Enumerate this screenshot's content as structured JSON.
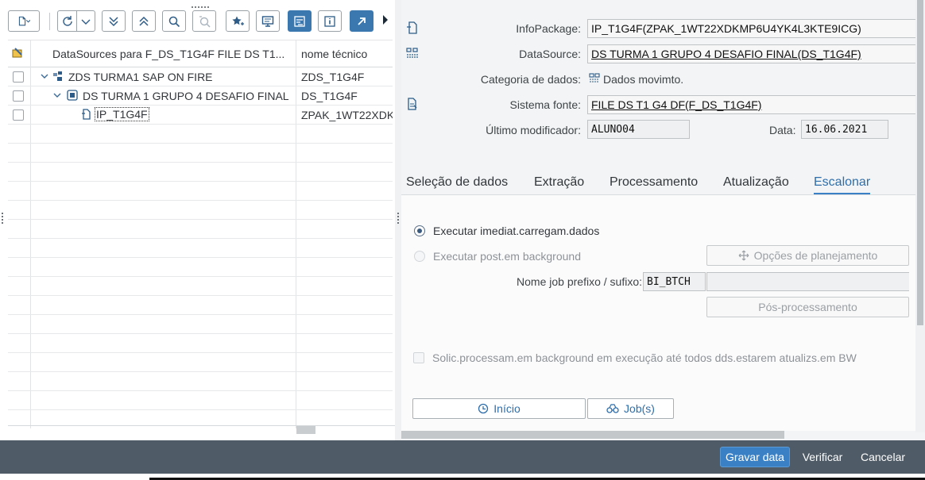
{
  "tree": {
    "header_col1": "DataSources para F_DS_T1G4F FILE DS T1...",
    "header_col2": "nome técnico",
    "rows": [
      {
        "label": "ZDS TURMA1 SAP ON FIRE",
        "tech": "ZDS_T1G4F",
        "level": 1
      },
      {
        "label": "DS TURMA 1 GRUPO 4 DESAFIO FINAL",
        "tech": "DS_T1G4F",
        "level": 2
      },
      {
        "label": "IP_T1G4F",
        "tech": "ZPAK_1WT22XDK",
        "level": 3
      }
    ]
  },
  "details": {
    "infopackage_label": "InfoPackage:",
    "infopackage_value": "IP_T1G4F(ZPAK_1WT22XDKMP6U4YK4L3KTE9ICG)",
    "datasource_label": "DataSource:",
    "datasource_value": "DS TURMA 1 GRUPO 4 DESAFIO FINAL(DS_T1G4F)",
    "category_label": "Categoria de dados:",
    "category_value": "Dados movimto.",
    "source_label": "Sistema fonte:",
    "source_value": "FILE DS T1 G4 DF(F_DS_T1G4F)",
    "modifier_label": "Último modificador:",
    "modifier_value": "ALUNO04",
    "date_label": "Data:",
    "date_value": "16.06.2021"
  },
  "tabs": [
    "Seleção de dados",
    "Extração",
    "Processamento",
    "Atualização",
    "Escalonar"
  ],
  "active_tab": "Escalonar",
  "schedule": {
    "radio_immediate": "Executar imediat.carregam.dados",
    "radio_background": "Executar post.em background",
    "planning_options": "Opções de planejamento",
    "job_prefix_label": "Nome job prefixo / sufixo:",
    "job_prefix_value": "BI_BTCH",
    "job_suffix_value": "",
    "post_processing": "Pós-processamento",
    "checkbox_label": "Solic.processam.em background em execução até todos dds.estarem atualizs.em BW",
    "start_button": "Início",
    "jobs_button": "Job(s)"
  },
  "footer": {
    "save": "Gravar data",
    "check": "Verificar",
    "cancel": "Cancelar"
  },
  "colors": {
    "accent": "#3a80c4",
    "footer_bg": "#4f5b66",
    "link_blue": "#2f6eaa"
  }
}
